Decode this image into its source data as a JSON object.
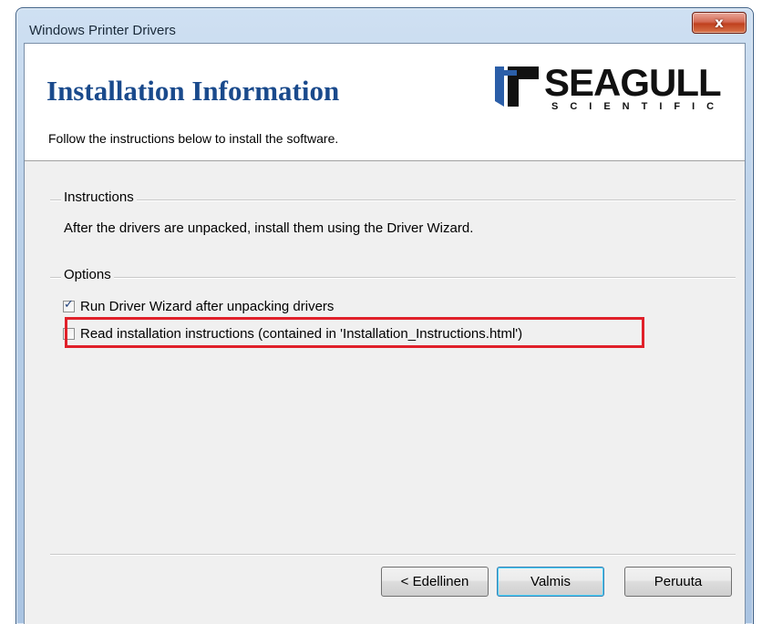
{
  "window": {
    "title": "Windows Printer Drivers",
    "close_glyph": "x",
    "close_icon": "close-icon"
  },
  "header": {
    "title": "Installation Information",
    "subtitle": "Follow the instructions below to install the software.",
    "logo": {
      "word": "SEAGULL",
      "sub": "SCIENTIFIC",
      "icon": "seagull-logo-mark"
    }
  },
  "instructions": {
    "label": "Instructions",
    "text": "After the drivers are unpacked, install them using the Driver Wizard."
  },
  "options": {
    "label": "Options",
    "items": [
      {
        "label": "Run Driver Wizard after unpacking drivers",
        "checked": true
      },
      {
        "label": "Read installation instructions (contained in 'Installation_Instructions.html')",
        "checked": false
      }
    ]
  },
  "buttons": {
    "back": "< Edellinen",
    "finish": "Valmis",
    "cancel": "Peruuta"
  },
  "colors": {
    "title_blue": "#1a4a8c",
    "highlight_red": "#e0202a",
    "check_blue": "#1e3f7a"
  }
}
